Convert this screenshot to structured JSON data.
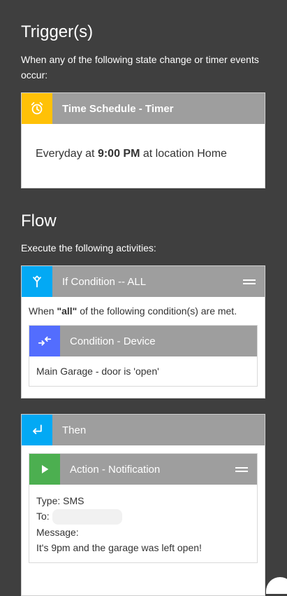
{
  "triggers": {
    "title": "Trigger(s)",
    "description": "When any of the following state change or timer events occur:",
    "card": {
      "header": "Time Schedule - Timer",
      "icon": "alarm-clock-icon",
      "icon_color": "#ffc107",
      "body_prefix": "Everyday at ",
      "body_time": "9:00 PM",
      "body_suffix": " at location Home"
    }
  },
  "flow": {
    "title": "Flow",
    "description": "Execute the following activities:",
    "if_card": {
      "header": "If Condition -- ALL",
      "icon": "merge-icon",
      "icon_color": "#03a9f4",
      "body_prefix": "When ",
      "body_quoted": "\"all\"",
      "body_suffix": " of the following condition(s) are met.",
      "condition": {
        "header": "Condition - Device",
        "icon": "swap-arrows-icon",
        "icon_color": "#536dfe",
        "device": "Main Garage - door",
        "is_word": " is ",
        "value": "'open'"
      }
    },
    "then_card": {
      "header": "Then",
      "icon": "enter-return-icon",
      "icon_color": "#03a9f4",
      "action": {
        "header": "Action - Notification",
        "icon": "play-icon",
        "icon_color": "#4caf50",
        "type_label": "Type:",
        "type_value": " SMS",
        "to_label": "To:",
        "message_label": "Message:",
        "message_value": "It's 9pm and the garage was left open!"
      }
    }
  }
}
